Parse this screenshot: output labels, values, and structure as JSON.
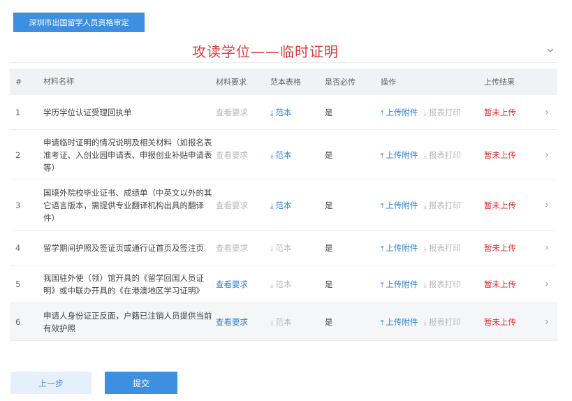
{
  "top_tab": {
    "label": "深圳市出国留学人员资格审定"
  },
  "page_title": "攻读学位——临时证明",
  "icons": {
    "collapse": "chevron-down-icon",
    "template_download": "download-icon",
    "upload": "upload-icon",
    "row_arrow": "chevron-right-icon"
  },
  "colors": {
    "primary": "#3d8fe0",
    "title_red": "#e23a3a",
    "status_red": "#e02b2b",
    "link_blue": "#2b7fd6",
    "muted_gray": "#b8b8b8"
  },
  "table": {
    "headers": {
      "num": "#",
      "name": "材料名称",
      "requirement": "材料要求",
      "template": "范本表格",
      "required": "是否必传",
      "operation": "操作",
      "result": "上传结果"
    },
    "rows": [
      {
        "num": "1",
        "name": "学历学位认证受理回执单",
        "requirement": "查看要求",
        "template": "范本",
        "required": "是",
        "upload": "上传附件",
        "print": "报表打印",
        "result": "暂未上传"
      },
      {
        "num": "2",
        "name": "申请临时证明的情况说明及相关材料（如报名表准考证、入创业园申请表、申报创业补贴申请表等）",
        "requirement": "查看要求",
        "template": "范本",
        "required": "是",
        "upload": "上传附件",
        "print": "报表打印",
        "result": "暂未上传"
      },
      {
        "num": "3",
        "name": "国境外院校毕业证书、成绩单（中英文以外的其它语言版本，需提供专业翻译机构出具的翻译件）",
        "requirement": "查看要求",
        "template": "范本",
        "required": "是",
        "upload": "上传附件",
        "print": "报表打印",
        "result": "暂未上传"
      },
      {
        "num": "4",
        "name": "留学期间护照及签证页或通行证首页及签注页",
        "requirement": "查看要求",
        "template": "范本",
        "required": "是",
        "upload": "上传附件",
        "print": "报表打印",
        "result": "暂未上传"
      },
      {
        "num": "5",
        "name": "我国驻外使（领）馆开具的《留学回国人员证明》或中联办开具的《在港澳地区学习证明》",
        "requirement": "查看要求",
        "template": "范本",
        "required": "是",
        "upload": "上传附件",
        "print": "报表打印",
        "result": "暂未上传"
      },
      {
        "num": "6",
        "name": "申请人身份证正反面，户籍已注销人员提供当前有效护照",
        "requirement": "查看要求",
        "template": "范本",
        "required": "是",
        "upload": "上传附件",
        "print": "报表打印",
        "result": "暂未上传"
      }
    ]
  },
  "buttons": {
    "prev": "上一步",
    "submit": "提交"
  }
}
